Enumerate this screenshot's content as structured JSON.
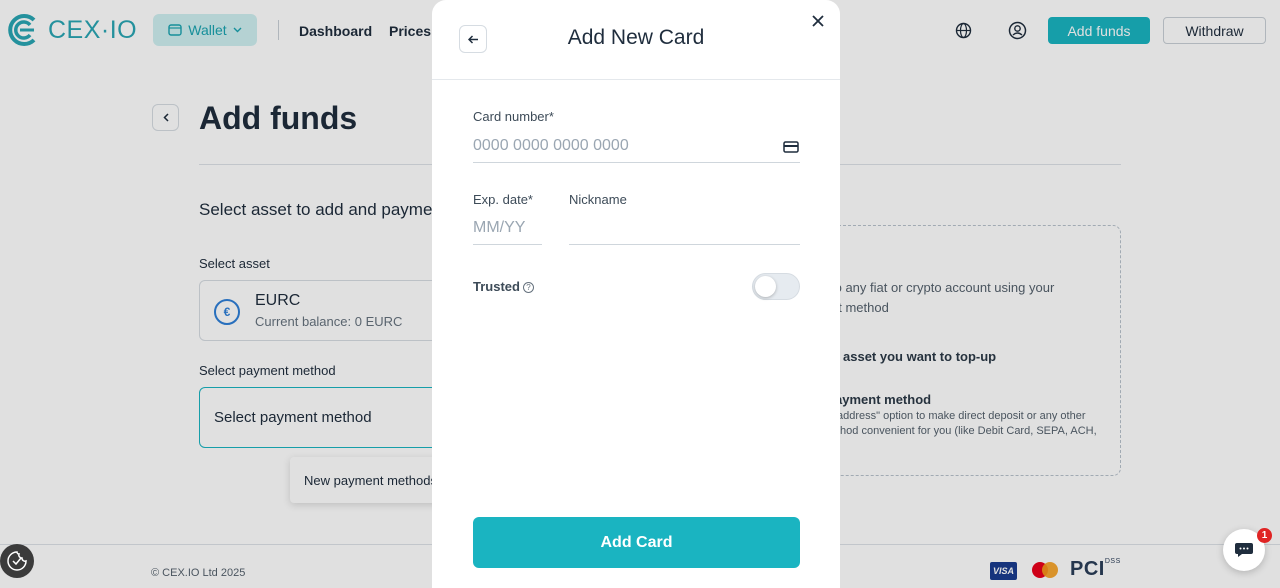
{
  "header": {
    "logo_text": "CEX·IO",
    "wallet_label": "Wallet",
    "nav": [
      "Dashboard",
      "Prices"
    ],
    "add_funds_label": "Add funds",
    "withdraw_label": "Withdraw"
  },
  "page": {
    "title": "Add funds",
    "section_text": "Select asset to add and payment",
    "select_asset_label": "Select asset",
    "asset": {
      "name": "EURC",
      "balance": "Current balance: 0 EURC"
    },
    "select_payment_label": "Select payment method",
    "payment_placeholder": "Select payment method",
    "tooltip_text": "New payment methods"
  },
  "info": {
    "line1": "to any fiat or crypto account using your",
    "line2": "nt method",
    "line3": "asset you want to top-up",
    "line4": "ayment method",
    "line5": "address\" option to make direct deposit or any other",
    "line6": "thod convenient for you (like Debit Card, SEPA, ACH,"
  },
  "footer": {
    "copyright": "© CEX.IO Ltd 2025",
    "visa": "VISA",
    "pci": "PCI",
    "pci_sup": "DSS"
  },
  "chat": {
    "badge_count": "1"
  },
  "modal": {
    "title": "Add New Card",
    "card_number_label": "Card number*",
    "card_number_placeholder": "0000 0000 0000 0000",
    "exp_label": "Exp. date*",
    "exp_placeholder": "MM/YY",
    "nickname_label": "Nickname",
    "nickname_value": "",
    "trusted_label": "Trusted",
    "trusted_on": false,
    "submit_label": "Add Card"
  },
  "colors": {
    "accent": "#1ab4c1",
    "brand": "#2aa6b3",
    "text": "#1f2d3d"
  }
}
